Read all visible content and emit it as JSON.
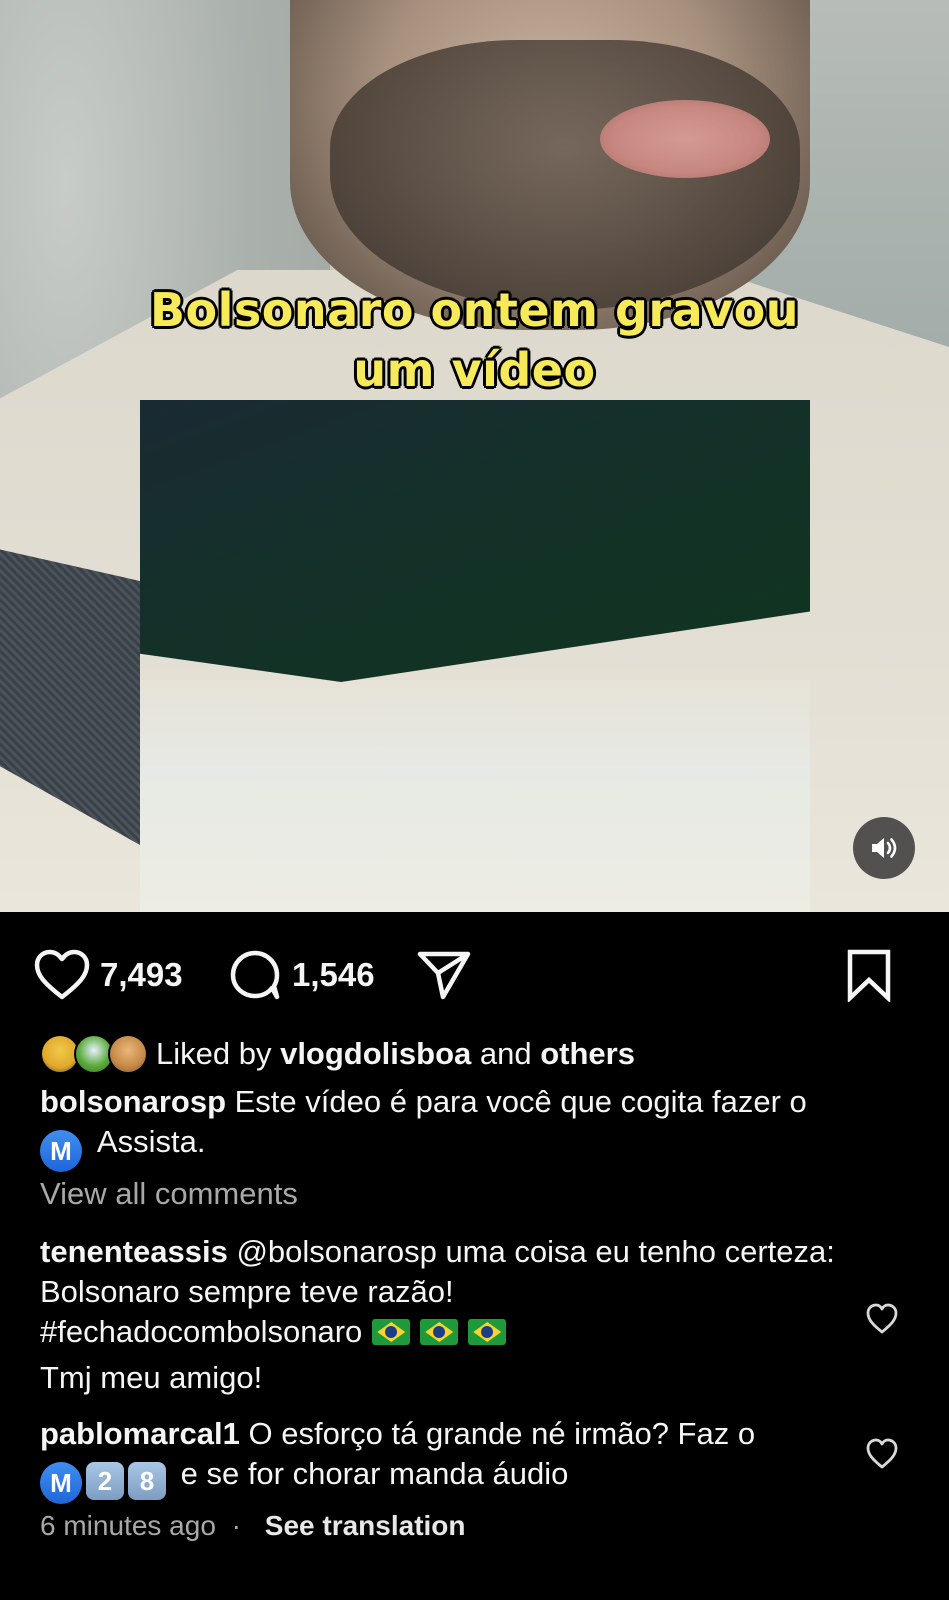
{
  "video": {
    "caption_line1": "Bolsonaro ontem gravou",
    "caption_line2": "um vídeo",
    "mute_icon": "speaker-volume-icon"
  },
  "actions": {
    "like_icon": "heart-icon",
    "like_count": "7,493",
    "comment_icon": "comment-bubble-icon",
    "comment_count": "1,546",
    "share_icon": "send-icon",
    "save_icon": "bookmark-icon"
  },
  "likes": {
    "prefix": "Liked by ",
    "user": "vlogdolisboa",
    "middle": " and ",
    "others": "others"
  },
  "post": {
    "username": "bolsonarosp",
    "text1": " Este vídeo é para você que cogita fazer o",
    "badge": "M",
    "text2": " Assista."
  },
  "view_all_comments": "View all comments",
  "comments": [
    {
      "username": "tenenteassis",
      "mention": "@bolsonarosp",
      "text": " uma coisa eu tenho certeza: Bolsonaro sempre teve razão!",
      "hashtag": "#fechadocombolsonaro",
      "line2": "Tmj meu amigo!"
    },
    {
      "username": "pablomarcal1",
      "text": " O esforço tá grande né irmão? Faz o",
      "badge_m": "M",
      "badge_2": "2",
      "badge_8": "8",
      "text2": " e se for chorar manda áudio"
    }
  ],
  "meta": {
    "time": "6 minutes ago",
    "separator": "·",
    "see_translation": "See translation"
  }
}
